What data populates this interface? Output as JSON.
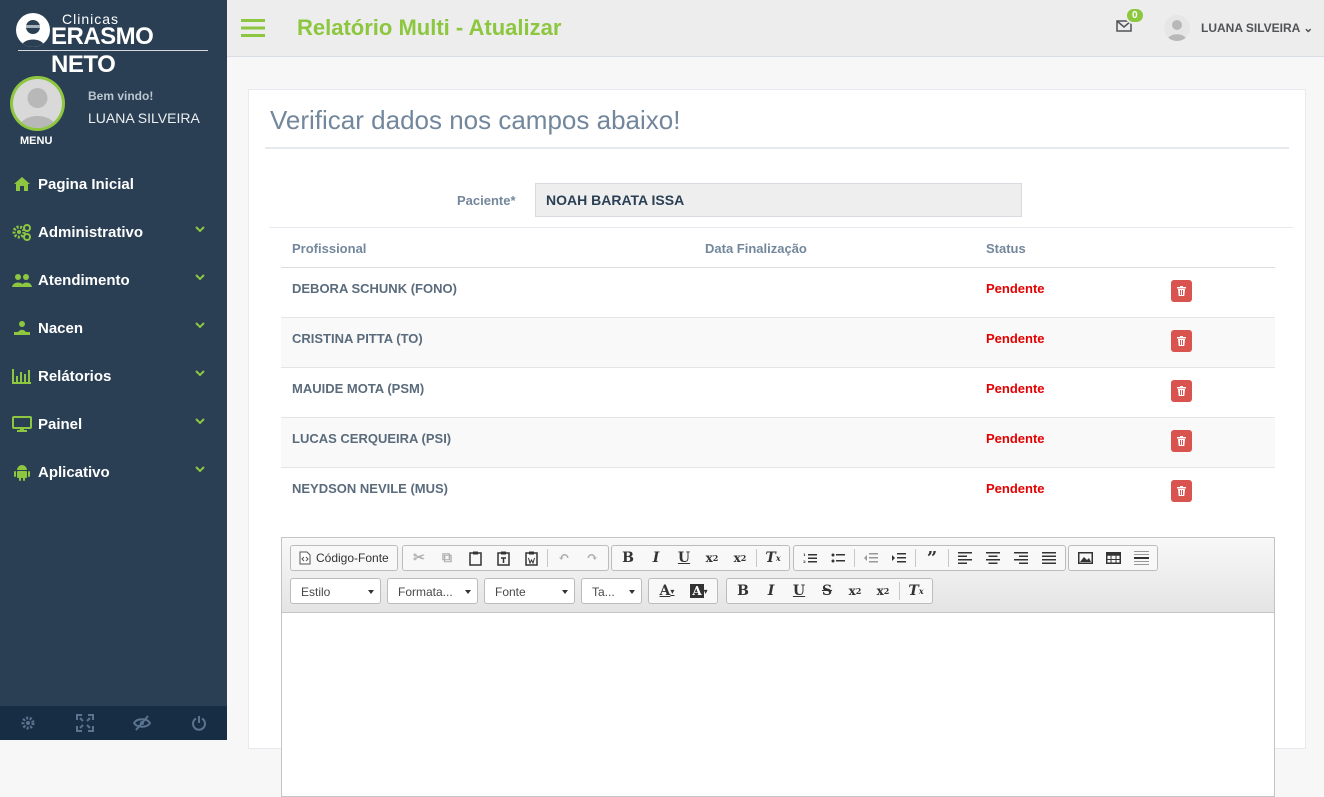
{
  "logo": {
    "line1": "Clinicas",
    "line2": "ERASMO NETO"
  },
  "profile": {
    "welcome": "Bem vindo!",
    "name": "LUANA SILVEIRA",
    "menu_label": "MENU"
  },
  "nav": {
    "items": [
      {
        "label": "Pagina Inicial",
        "icon": "home-icon",
        "has_chevron": false
      },
      {
        "label": "Administrativo",
        "icon": "cogs-icon",
        "has_chevron": true
      },
      {
        "label": "Atendimento",
        "icon": "users-icon",
        "has_chevron": true
      },
      {
        "label": "Nacen",
        "icon": "sitemap-icon",
        "has_chevron": true
      },
      {
        "label": "Relátorios",
        "icon": "bar-chart-icon",
        "has_chevron": true
      },
      {
        "label": "Painel",
        "icon": "desktop-icon",
        "has_chevron": true
      },
      {
        "label": "Aplicativo",
        "icon": "android-icon",
        "has_chevron": true
      }
    ],
    "footer_icons": [
      "settings-icon",
      "fullscreen-icon",
      "eye-slash-icon",
      "power-icon"
    ]
  },
  "topbar": {
    "title": "Relatório Multi - Atualizar",
    "mail_count": "0",
    "user_name": "LUANA SILVEIRA"
  },
  "form": {
    "heading": "Verificar dados nos campos abaixo!",
    "patient_label": "Paciente*",
    "patient_value": "NOAH BARATA ISSA"
  },
  "table": {
    "headers": {
      "profissional": "Profissional",
      "data": "Data Finalização",
      "status": "Status"
    },
    "rows": [
      {
        "profissional": "DEBORA SCHUNK (FONO)",
        "data": "",
        "status": "Pendente"
      },
      {
        "profissional": "CRISTINA PITTA (TO)",
        "data": "",
        "status": "Pendente"
      },
      {
        "profissional": "MAUIDE MOTA (PSM)",
        "data": "",
        "status": "Pendente"
      },
      {
        "profissional": "LUCAS CERQUEIRA (PSI)",
        "data": "",
        "status": "Pendente"
      },
      {
        "profissional": "NEYDSON NEVILE (MUS)",
        "data": "",
        "status": "Pendente"
      }
    ]
  },
  "editor": {
    "source_label": "Código-Fonte",
    "combos": {
      "style": "Estilo",
      "format": "Formata...",
      "font": "Fonte",
      "size": "Ta..."
    }
  },
  "colors": {
    "sidebar": "#2a3f54",
    "accent": "#8dc63f",
    "danger": "#d9534f",
    "status_pending": "#e50000"
  }
}
